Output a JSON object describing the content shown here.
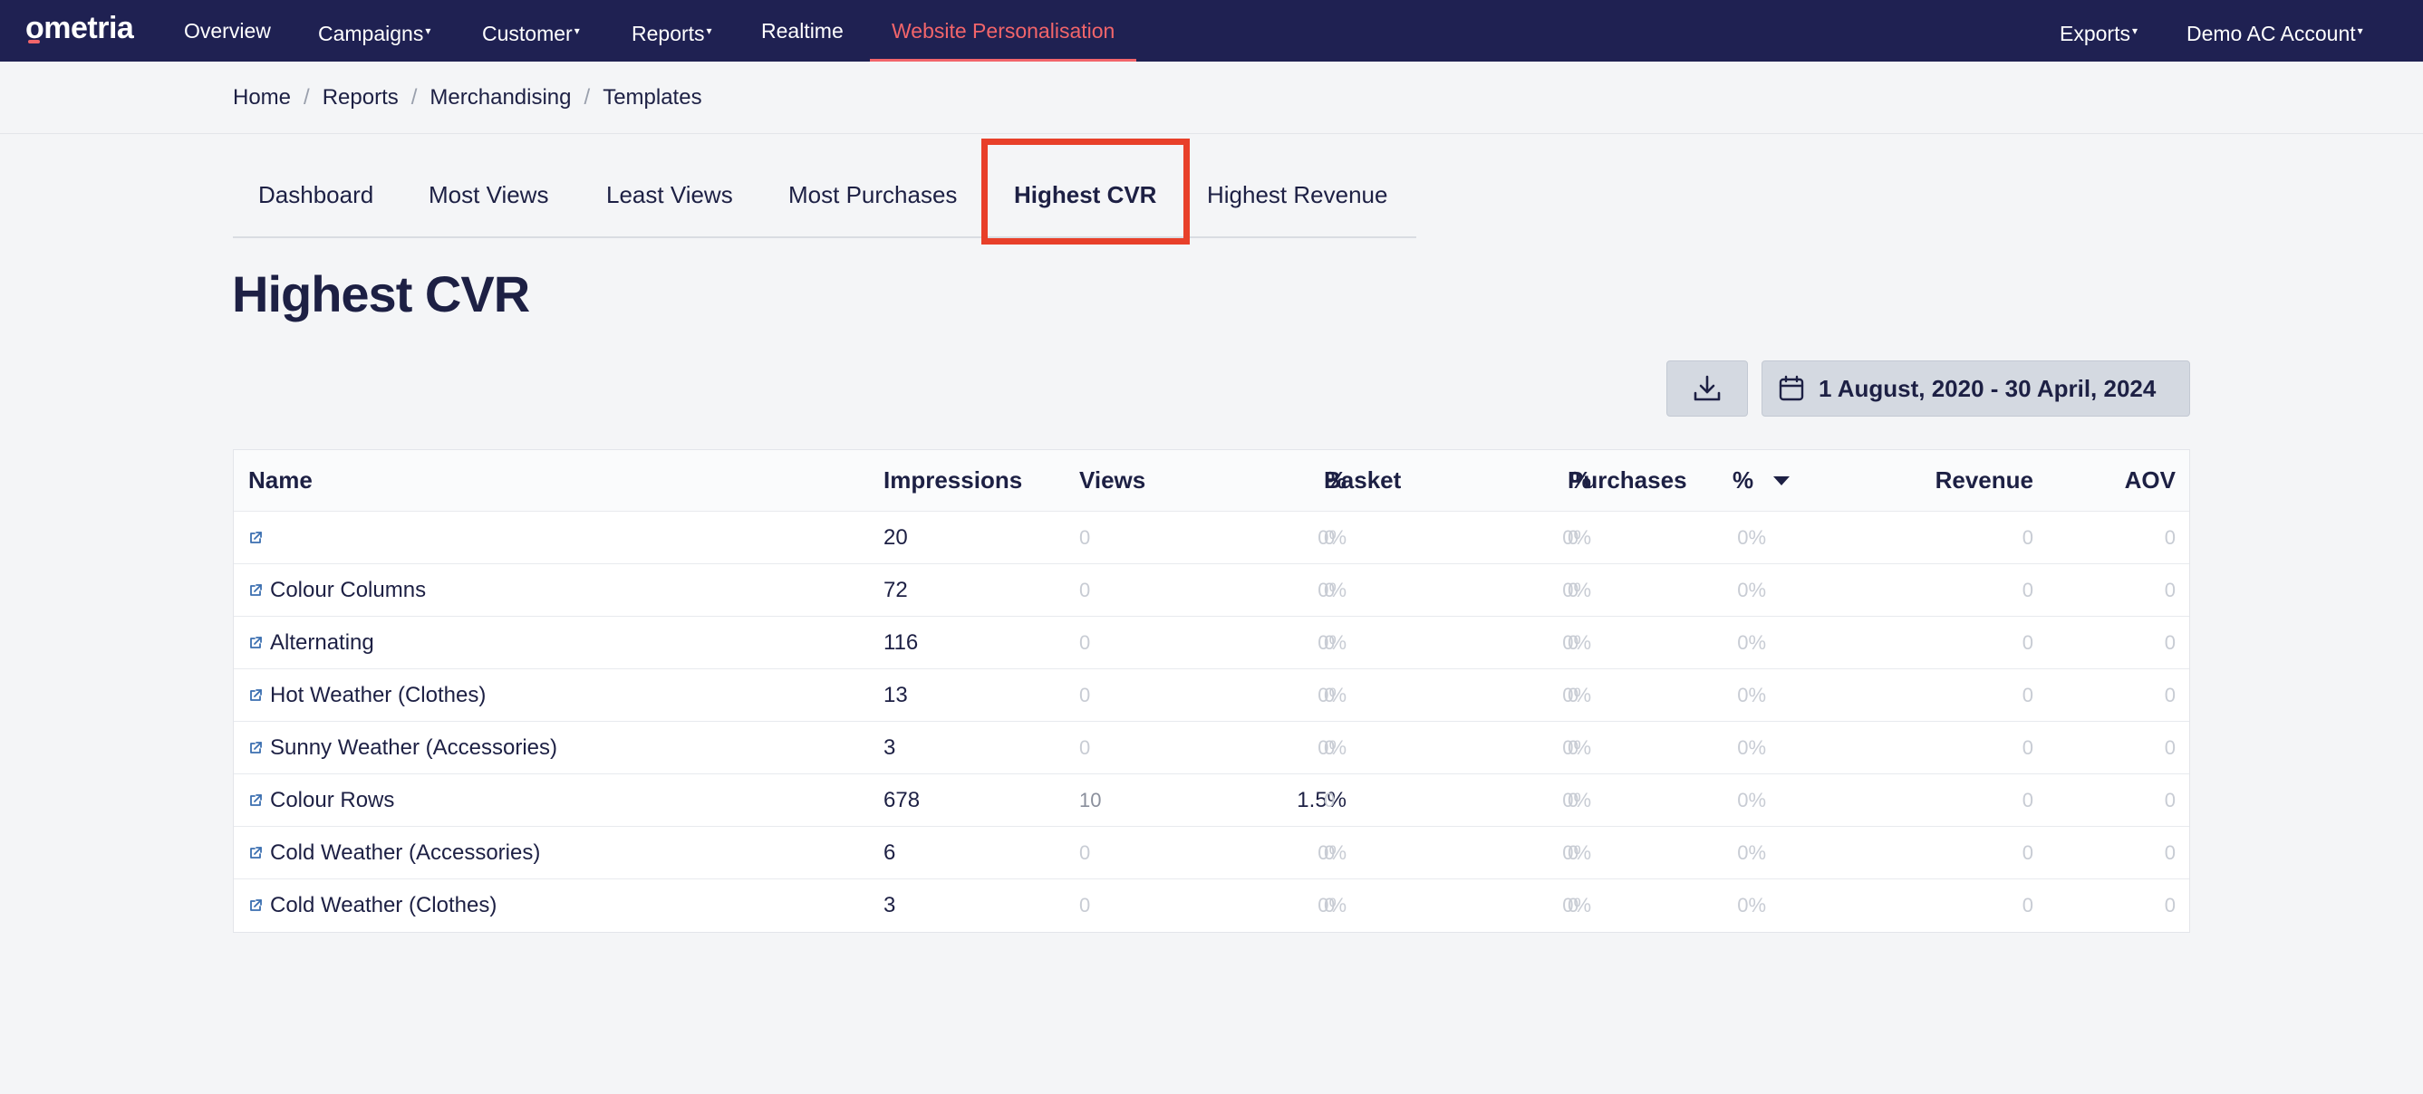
{
  "app": {
    "logo": "ometria",
    "nav": [
      "Overview",
      "Campaigns",
      "Customer",
      "Reports",
      "Realtime",
      "Website Personalisation"
    ],
    "right_nav": [
      "Exports",
      "Demo AC Account"
    ],
    "caret": "▾",
    "accent_color": "#f2656a",
    "nav_bg": "#1f2152"
  },
  "breadcrumb": [
    "Home",
    "Reports",
    "Merchandising",
    "Templates"
  ],
  "breadcrumb_sep": "/",
  "tabs": [
    "Dashboard",
    "Most Views",
    "Least Views",
    "Most Purchases",
    "Highest CVR",
    "Highest Revenue"
  ],
  "active_tab": "Highest CVR",
  "page_title": "Highest CVR",
  "toolbar": {
    "download_icon": "download-icon",
    "date_range": "1 August, 2020 - 30 April, 2024",
    "calendar_icon": "calendar-icon"
  },
  "table": {
    "columns": [
      "Name",
      "Impressions",
      "Views",
      "%",
      "Basket",
      "%",
      "Purchases",
      "%",
      "Revenue",
      "AOV"
    ],
    "sorted_column": "Purchases %",
    "rows": [
      {
        "name": "",
        "impressions": "20",
        "views": "0",
        "views_pct": "0%",
        "basket": "0",
        "basket_pct": "0%",
        "purchases": "0",
        "purchases_pct": "0%",
        "revenue": "0",
        "aov": "0"
      },
      {
        "name": "Colour Columns",
        "impressions": "72",
        "views": "0",
        "views_pct": "0%",
        "basket": "0",
        "basket_pct": "0%",
        "purchases": "0",
        "purchases_pct": "0%",
        "revenue": "0",
        "aov": "0"
      },
      {
        "name": "Alternating",
        "impressions": "116",
        "views": "0",
        "views_pct": "0%",
        "basket": "0",
        "basket_pct": "0%",
        "purchases": "0",
        "purchases_pct": "0%",
        "revenue": "0",
        "aov": "0"
      },
      {
        "name": "Hot Weather (Clothes)",
        "impressions": "13",
        "views": "0",
        "views_pct": "0%",
        "basket": "0",
        "basket_pct": "0%",
        "purchases": "0",
        "purchases_pct": "0%",
        "revenue": "0",
        "aov": "0"
      },
      {
        "name": "Sunny Weather (Accessories)",
        "impressions": "3",
        "views": "0",
        "views_pct": "0%",
        "basket": "0",
        "basket_pct": "0%",
        "purchases": "0",
        "purchases_pct": "0%",
        "revenue": "0",
        "aov": "0"
      },
      {
        "name": "Colour Rows",
        "impressions": "678",
        "views": "10",
        "views_pct": "1.5%",
        "basket": "0",
        "basket_pct": "0%",
        "purchases": "0",
        "purchases_pct": "0%",
        "revenue": "0",
        "aov": "0"
      },
      {
        "name": "Cold Weather (Accessories)",
        "impressions": "6",
        "views": "0",
        "views_pct": "0%",
        "basket": "0",
        "basket_pct": "0%",
        "purchases": "0",
        "purchases_pct": "0%",
        "revenue": "0",
        "aov": "0"
      },
      {
        "name": "Cold Weather (Clothes)",
        "impressions": "3",
        "views": "0",
        "views_pct": "0%",
        "basket": "0",
        "basket_pct": "0%",
        "purchases": "0",
        "purchases_pct": "0%",
        "revenue": "0",
        "aov": "0"
      }
    ]
  }
}
